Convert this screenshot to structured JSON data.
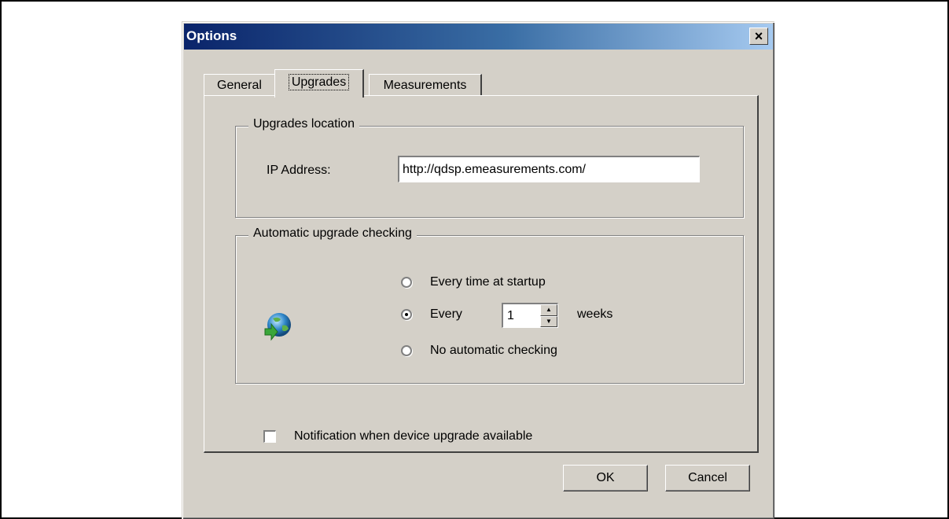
{
  "dialog": {
    "title": "Options",
    "close_glyph": "×",
    "close_icon": "close-icon"
  },
  "tabs": [
    {
      "label": "General",
      "active": false
    },
    {
      "label": "Upgrades",
      "active": true
    },
    {
      "label": "Measurements",
      "active": false
    }
  ],
  "upgrades_location": {
    "legend": "Upgrades location",
    "ip_label": "IP Address:",
    "ip_value": "http://qdsp.emeasurements.com/"
  },
  "auto_check": {
    "legend": "Automatic upgrade checking",
    "icon": "globe-download-icon",
    "options": [
      {
        "label": "Every time at startup",
        "selected": false
      },
      {
        "label": "Every",
        "selected": true
      },
      {
        "label": "No automatic checking",
        "selected": false
      }
    ],
    "interval_value": "1",
    "interval_unit": "weeks"
  },
  "notification": {
    "label": "Notification when device upgrade available",
    "checked": false
  },
  "buttons": {
    "ok": "OK",
    "cancel": "Cancel"
  },
  "colors": {
    "face": "#d4d0c8",
    "title_start": "#0a246a",
    "title_end": "#a6caf0"
  }
}
